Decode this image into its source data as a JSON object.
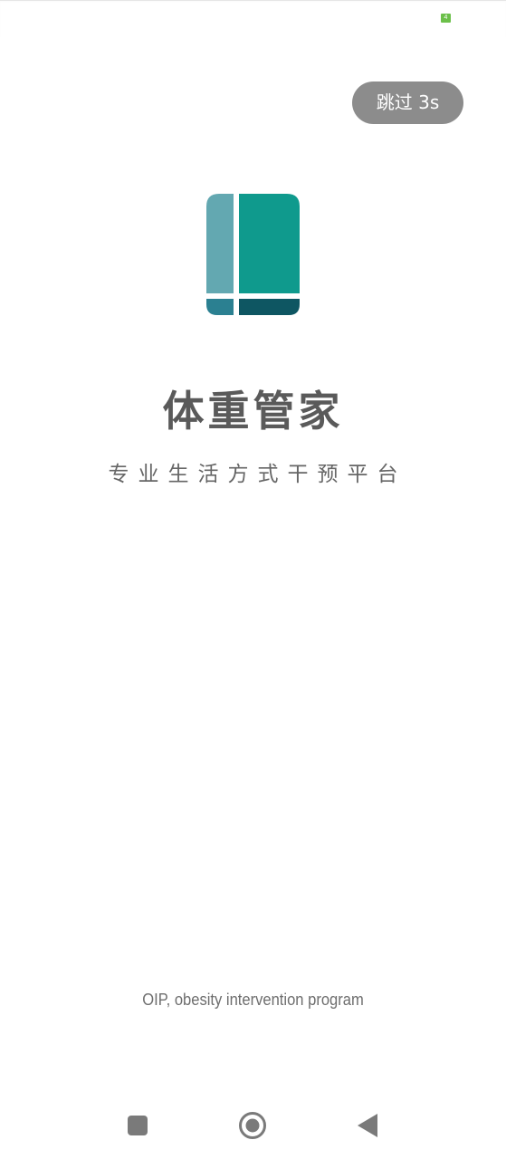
{
  "status_bar": {
    "battery_label": "4",
    "battery_color": "#6cc04a"
  },
  "splash": {
    "skip_label": "跳过 3s",
    "title": "体重管家",
    "subtitle": "专业生活方式干预平台",
    "footer": "OIP, obesity intervention program"
  },
  "logo": {
    "icon": "app-logo-icon",
    "colors": {
      "left_panel": "#63a8b1",
      "main_panel": "#0f9a8d",
      "bottom_left": "#2b8091",
      "bottom_right": "#0e5662"
    }
  },
  "nav_bar": {
    "icons": [
      "recents-square-icon",
      "home-circle-icon",
      "back-triangle-icon"
    ]
  }
}
